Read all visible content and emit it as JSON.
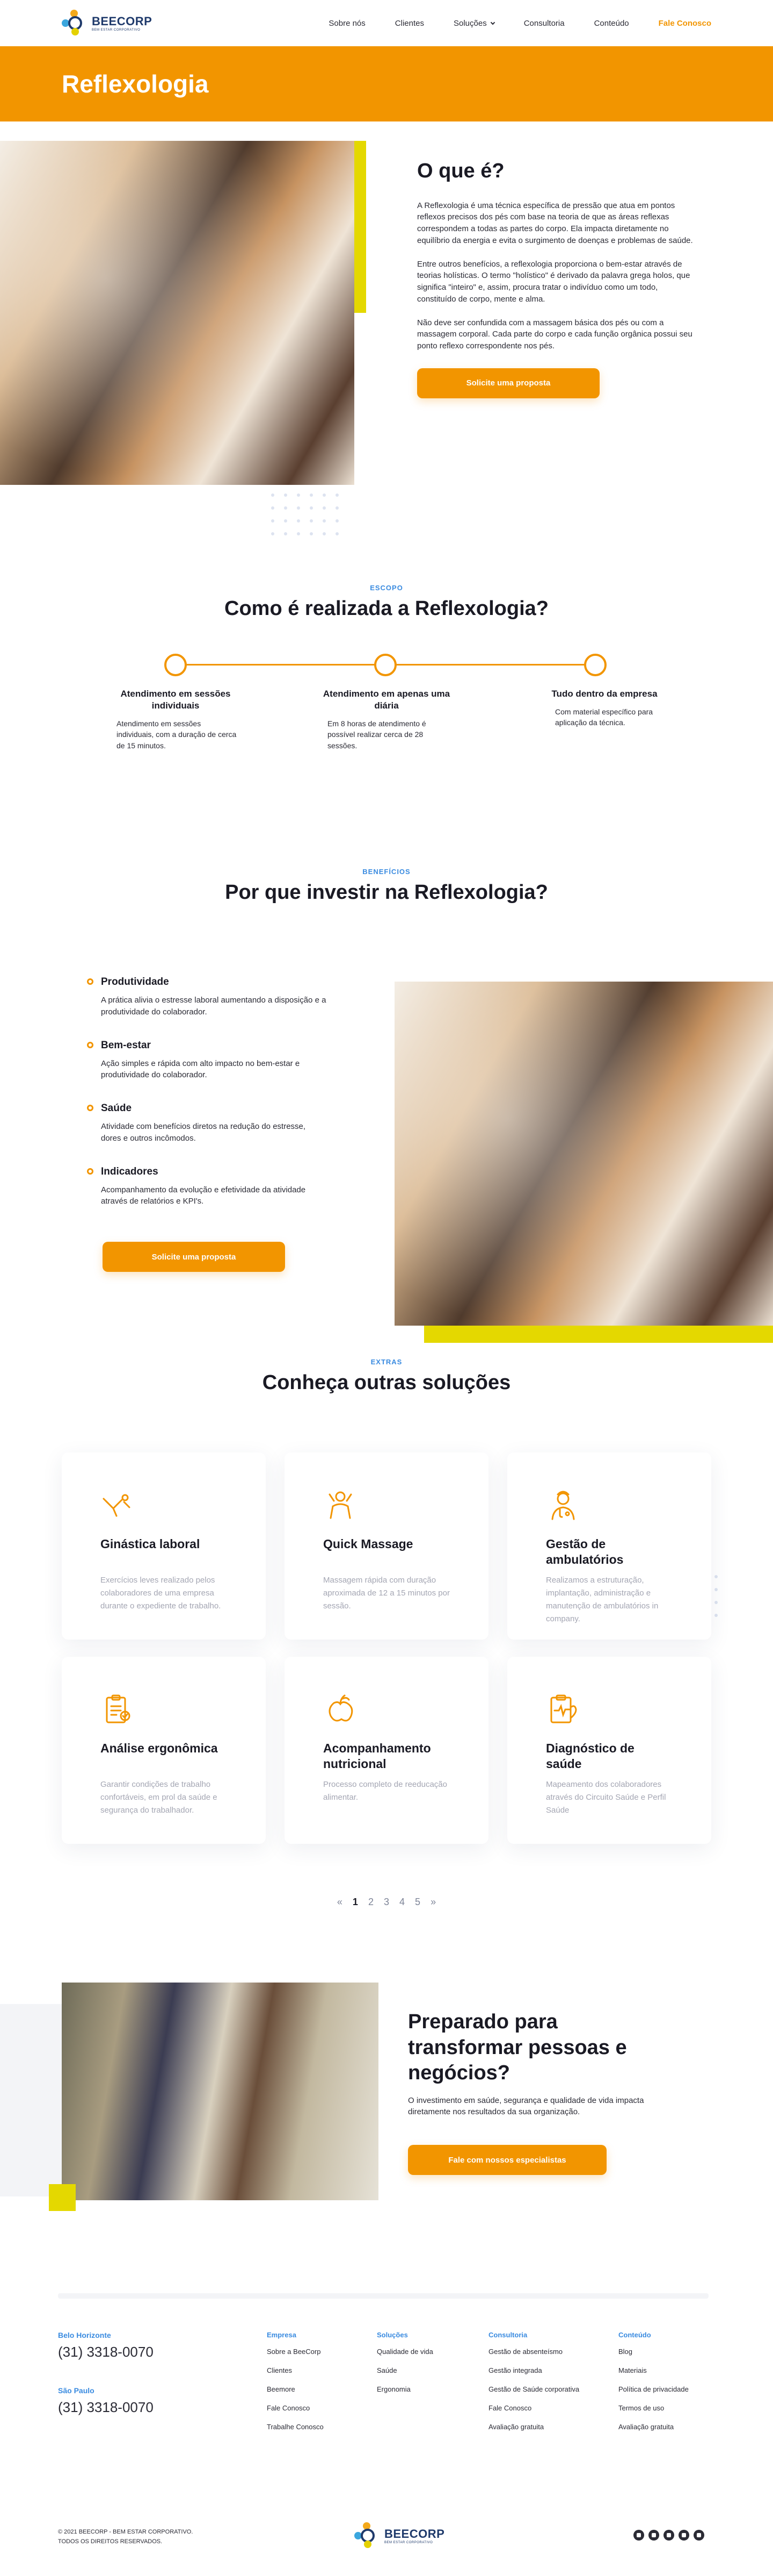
{
  "brand": {
    "name": "BEECORP",
    "tagline": "BEM ESTAR CORPORATIVO"
  },
  "nav": {
    "items": [
      "Sobre nós",
      "Clientes",
      "Soluções",
      "Consultoria",
      "Conteúdo"
    ],
    "cta": "Fale Conosco"
  },
  "hero": {
    "title": "Reflexologia"
  },
  "whatis": {
    "title": "O que é?",
    "paragraphs": [
      "A Reflexologia é uma técnica específica de pressão que atua em pontos reflexos precisos dos pés com base na teoria de que as áreas reflexas correspondem a todas as partes do corpo. Ela impacta diretamente no equilíbrio da energia e evita o surgimento de doenças e problemas de saúde.",
      "Entre outros benefícios, a reflexologia proporciona o bem-estar através de teorias holísticas. O termo \"holístico\" é derivado da palavra grega holos, que significa \"inteiro\" e, assim, procura tratar o indivíduo como um todo, constituído de corpo, mente e alma.",
      "Não deve ser confundida com a massagem básica dos pés ou com a massagem corporal. Cada parte do corpo e cada função orgânica possui seu ponto reflexo correspondente nos pés."
    ],
    "button": "Solicite uma proposta"
  },
  "escopo": {
    "eyebrow": "ESCOPO",
    "title": "Como é realizada a Reflexologia?",
    "steps": [
      {
        "title": "Atendimento em sessões individuais",
        "text": "Atendimento em sessões individuais, com a duração de cerca de 15 minutos."
      },
      {
        "title": "Atendimento em apenas uma diária",
        "text": "Em 8 horas de atendimento é possível realizar cerca de 28 sessões."
      },
      {
        "title": "Tudo dentro da empresa",
        "text": "Com material específico para aplicação da técnica."
      }
    ]
  },
  "beneficios": {
    "eyebrow": "BENEFÍCIOS",
    "title": "Por que investir na Reflexologia?",
    "items": [
      {
        "title": "Produtividade",
        "text": "A prática alivia o estresse laboral aumentando a disposição e a produtividade do colaborador."
      },
      {
        "title": "Bem-estar",
        "text": "Ação simples e rápida com alto impacto no bem-estar e produtividade do colaborador."
      },
      {
        "title": "Saúde",
        "text": "Atividade com benefícios diretos na redução do estresse, dores e outros incômodos."
      },
      {
        "title": "Indicadores",
        "text": "Acompanhamento da evolução e efetividade da atividade através de relatórios e KPI's."
      }
    ],
    "button": "Solicite uma proposta"
  },
  "extras": {
    "eyebrow": "EXTRAS",
    "title": "Conheça outras soluções",
    "cards": [
      {
        "icon": "gym-icon",
        "title": "Ginástica laboral",
        "text": "Exercícios leves realizado pelos colaboradores de uma empresa durante o expediente de trabalho."
      },
      {
        "icon": "massage-icon",
        "title": "Quick  Massage",
        "text": "Massagem rápida com duração aproximada de 12 a 15 minutos por sessão."
      },
      {
        "icon": "doctor-icon",
        "title": "Gestão de ambulatórios",
        "text": "Realizamos a estruturação, implantação, administração e manutenção de ambulatórios in company."
      },
      {
        "icon": "clipboard-icon",
        "title": "Análise ergonômica",
        "text": "Garantir condições de trabalho confortáveis, em prol da saúde e segurança do trabalhador."
      },
      {
        "icon": "nutrition-icon",
        "title": "Acompanhamento nutricional",
        "text": "Processo completo de reeducação alimentar."
      },
      {
        "icon": "health-diagnosis-icon",
        "title": "Diagnóstico de saúde",
        "text": "Mapeamento dos colaboradores através do Circuito Saúde e Perfil Saúde"
      }
    ],
    "pager": {
      "prev": "«",
      "pages": [
        "1",
        "2",
        "3",
        "4",
        "5"
      ],
      "next": "»"
    }
  },
  "cta": {
    "title": "Preparado para transformar pessoas e negócios?",
    "text": "O investimento em saúde, segurança e qualidade de vida impacta diretamente nos resultados da sua organização.",
    "button": "Fale com nossos especialistas"
  },
  "footer": {
    "contacts": [
      {
        "city": "Belo Horizonte",
        "phone": "(31) 3318-0070"
      },
      {
        "city": "São Paulo",
        "phone": "(31) 3318-0070"
      }
    ],
    "columns": [
      {
        "title": "Empresa",
        "links": [
          "Sobre a BeeCorp",
          "Clientes",
          "Beemore",
          "Fale Conosco",
          "Trabalhe Conosco"
        ]
      },
      {
        "title": "Soluções",
        "links": [
          "Qualidade de vida",
          "Saúde",
          "Ergonomia"
        ]
      },
      {
        "title": "Consultoria",
        "links": [
          "Gestão de absenteísmo",
          "Gestão integrada",
          "Gestão de Saúde corporativa",
          "Fale Conosco",
          "Avaliação gratuita"
        ]
      },
      {
        "title": "Conteúdo",
        "links": [
          "Blog",
          "Materiais",
          "Política de privacidade",
          "Termos de uso",
          "Avaliação gratuita"
        ]
      }
    ],
    "copyright_1": "© 2021 BEECORP - BEM ESTAR CORPORATIVO.",
    "copyright_2": "TODOS OS DIREITOS RESERVADOS.",
    "socials": [
      "linkedin-icon",
      "instagram-icon",
      "youtube-icon",
      "twitter-icon",
      "facebook-icon"
    ]
  }
}
